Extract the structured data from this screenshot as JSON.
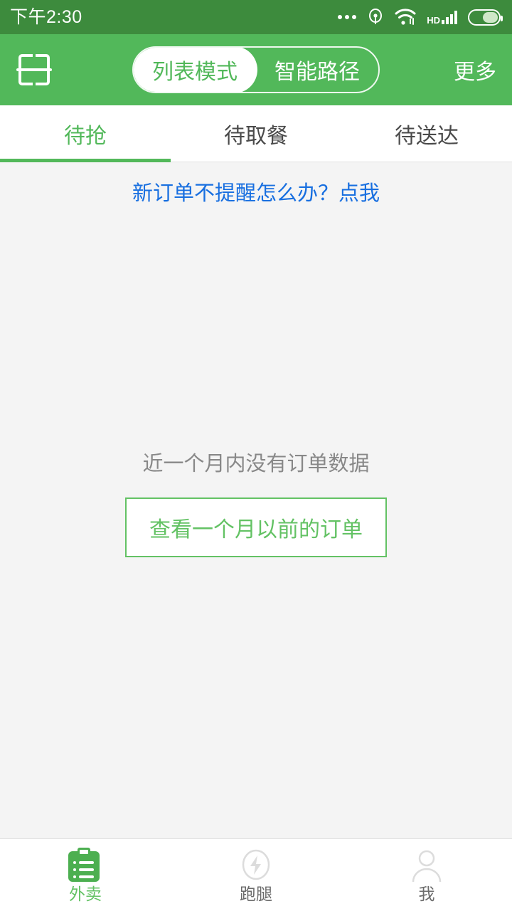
{
  "status_bar": {
    "time": "下午2:30",
    "icons": [
      "more-dots-icon",
      "vpn-icon",
      "wifi-icon",
      "hd-signal-icon",
      "battery-icon"
    ],
    "hd_label": "HD",
    "background": "#3d8b3d"
  },
  "nav_bar": {
    "scan_icon": "scan-code-icon",
    "segments": [
      {
        "label": "列表模式",
        "active": true
      },
      {
        "label": "智能路径",
        "active": false
      }
    ],
    "more_label": "更多",
    "background": "#52b85a"
  },
  "tabs": [
    {
      "label": "待抢",
      "active": true
    },
    {
      "label": "待取餐",
      "active": false
    },
    {
      "label": "待送达",
      "active": false
    }
  ],
  "content": {
    "notice": "新订单不提醒怎么办？点我",
    "notice_color": "#186fe0",
    "empty_text": "近一个月内没有订单数据",
    "older_orders_button": "查看一个月以前的订单",
    "accent_color": "#63c264",
    "background": "#f4f4f4"
  },
  "bottom_nav": [
    {
      "label": "外卖",
      "icon": "clipboard-list-icon",
      "active": true
    },
    {
      "label": "跑腿",
      "icon": "lightning-circle-icon",
      "active": false
    },
    {
      "label": "我",
      "icon": "person-icon",
      "active": false
    }
  ]
}
